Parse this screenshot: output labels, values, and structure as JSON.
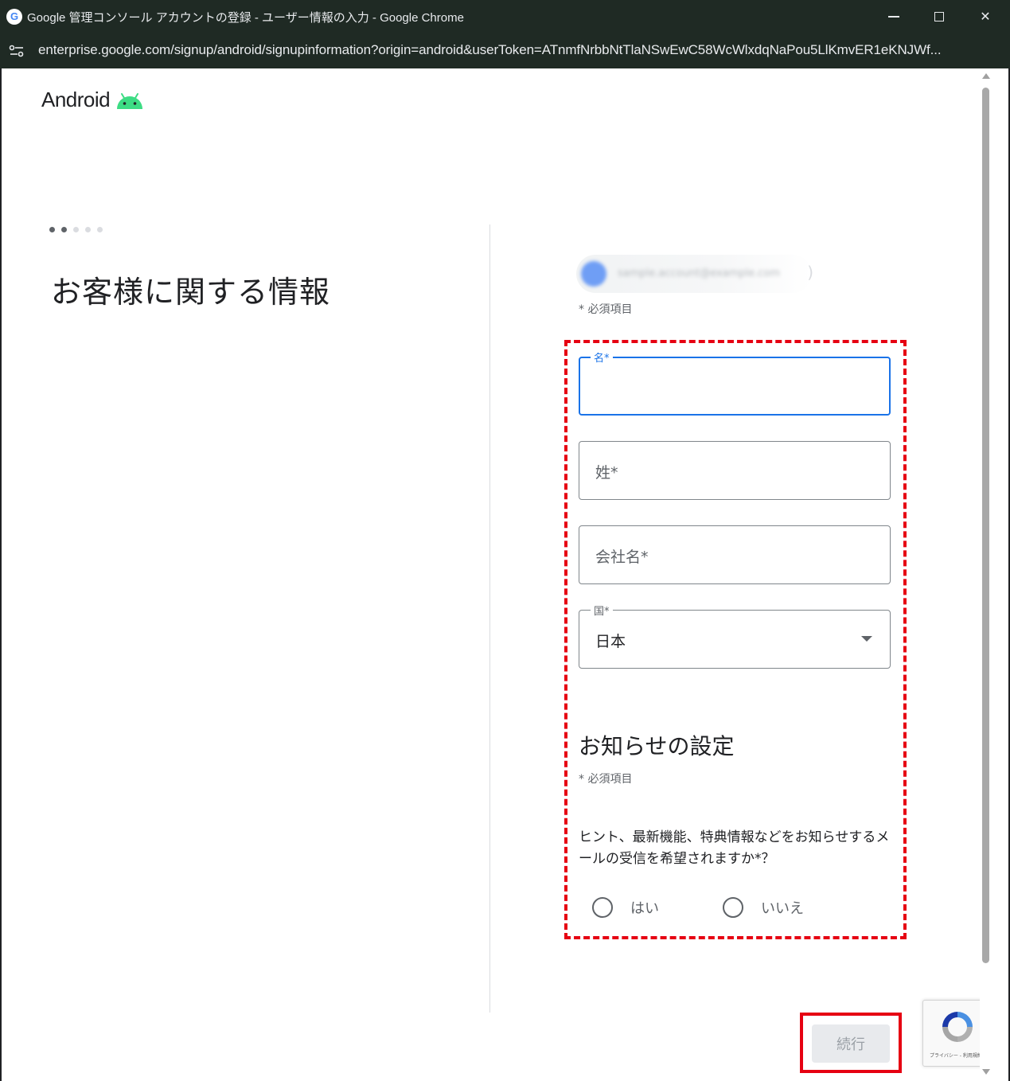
{
  "window": {
    "title": "Google 管理コンソール アカウントの登録 - ユーザー情報の入力 - Google Chrome",
    "url": "enterprise.google.com/signup/android/signupinformation?origin=android&userToken=ATnmfNrbbNtTlaNSwEwC58WcWlxdqNaPou5LlKmvER1eKNJWf..."
  },
  "brand": {
    "name": "Android",
    "icon": "android-bot-icon",
    "icon_color": "#3ddc84"
  },
  "steps": {
    "total": 5,
    "current": 2
  },
  "page": {
    "title": "お客様に関する情報"
  },
  "account": {
    "email": "sample.account@example.com"
  },
  "required_note": "* 必須項目",
  "form": {
    "first_name": {
      "label": "名*",
      "value": ""
    },
    "last_name": {
      "label": "姓*",
      "value": ""
    },
    "company": {
      "label": "会社名*",
      "value": ""
    },
    "country": {
      "label": "国*",
      "value": "日本"
    }
  },
  "notifications": {
    "title": "お知らせの設定",
    "required_note": "* 必須項目",
    "question": "ヒント、最新機能、特典情報などをお知らせするメールの受信を希望されますか*？",
    "options": [
      {
        "label": "はい",
        "selected": false
      },
      {
        "label": "いいえ",
        "selected": false
      }
    ]
  },
  "continue_button": {
    "label": "続行",
    "enabled": false
  },
  "recaptcha": {
    "footer": "プライバシー - 利用規約"
  },
  "colors": {
    "focus_blue": "#1a73e8",
    "highlight_red": "#e60012",
    "android_green": "#3ddc84"
  }
}
